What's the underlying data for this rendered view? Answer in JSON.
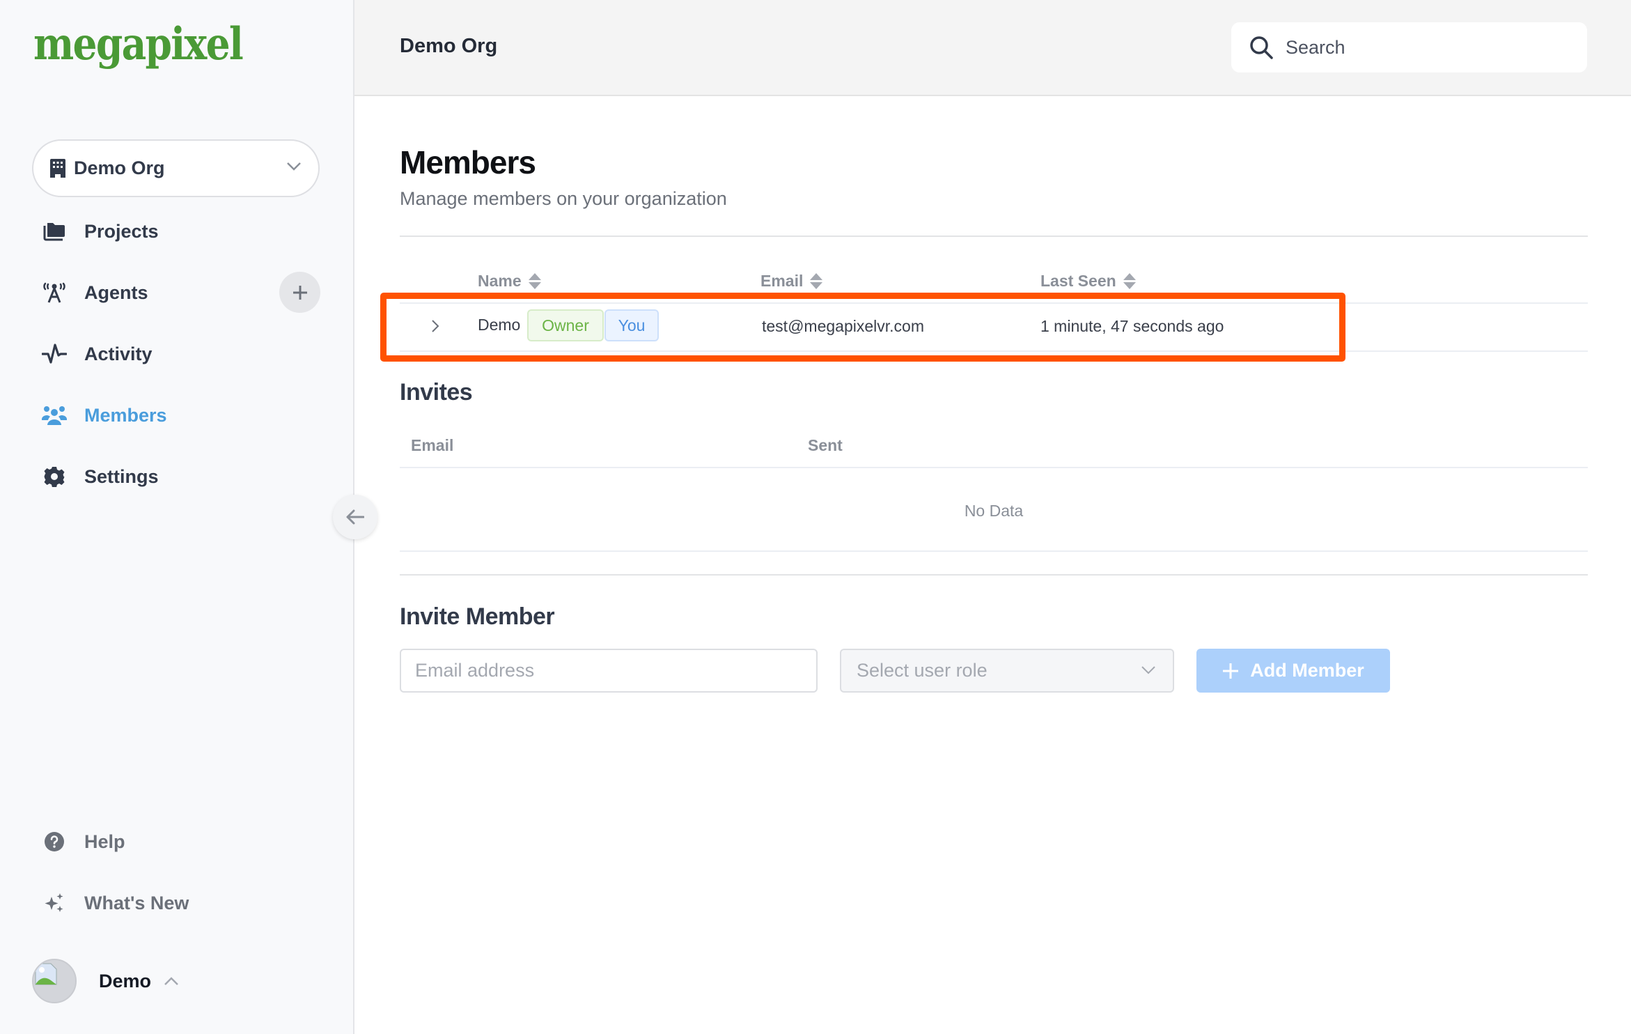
{
  "app": {
    "logo_text": "megapixel",
    "brand_color": "#4a9a36",
    "accent_color": "#4a9ddc",
    "highlight_color": "#ff5200"
  },
  "sidebar": {
    "org_selector": {
      "label": "Demo Org",
      "icon": "building-icon"
    },
    "items": [
      {
        "label": "Projects",
        "icon": "folder-icon",
        "active": false
      },
      {
        "label": "Agents",
        "icon": "antenna-icon",
        "active": false,
        "action": "add"
      },
      {
        "label": "Activity",
        "icon": "pulse-icon",
        "active": false
      },
      {
        "label": "Members",
        "icon": "users-icon",
        "active": true
      },
      {
        "label": "Settings",
        "icon": "gear-icon",
        "active": false
      }
    ],
    "bottom_items": [
      {
        "label": "Help",
        "icon": "help-circle-icon"
      },
      {
        "label": "What's New",
        "icon": "sparkles-icon"
      }
    ],
    "user": {
      "name": "Demo",
      "avatar": "broken-image-icon"
    }
  },
  "header": {
    "breadcrumb": "Demo Org",
    "search": {
      "placeholder": "Search",
      "value": ""
    }
  },
  "members": {
    "title": "Members",
    "subtitle": "Manage members on your organization",
    "columns": [
      "Name",
      "Email",
      "Last Seen"
    ],
    "rows": [
      {
        "name": "Demo",
        "tags": [
          "Owner",
          "You"
        ],
        "email": "test@megapixelvr.com",
        "last_seen": "1 minute, 47 seconds ago"
      }
    ]
  },
  "invites": {
    "title": "Invites",
    "columns": [
      "Email",
      "Sent"
    ],
    "empty_text": "No Data"
  },
  "invite_member": {
    "title": "Invite Member",
    "email_placeholder": "Email address",
    "email_value": "",
    "role_placeholder": "Select user role",
    "add_button_label": "Add Member"
  }
}
